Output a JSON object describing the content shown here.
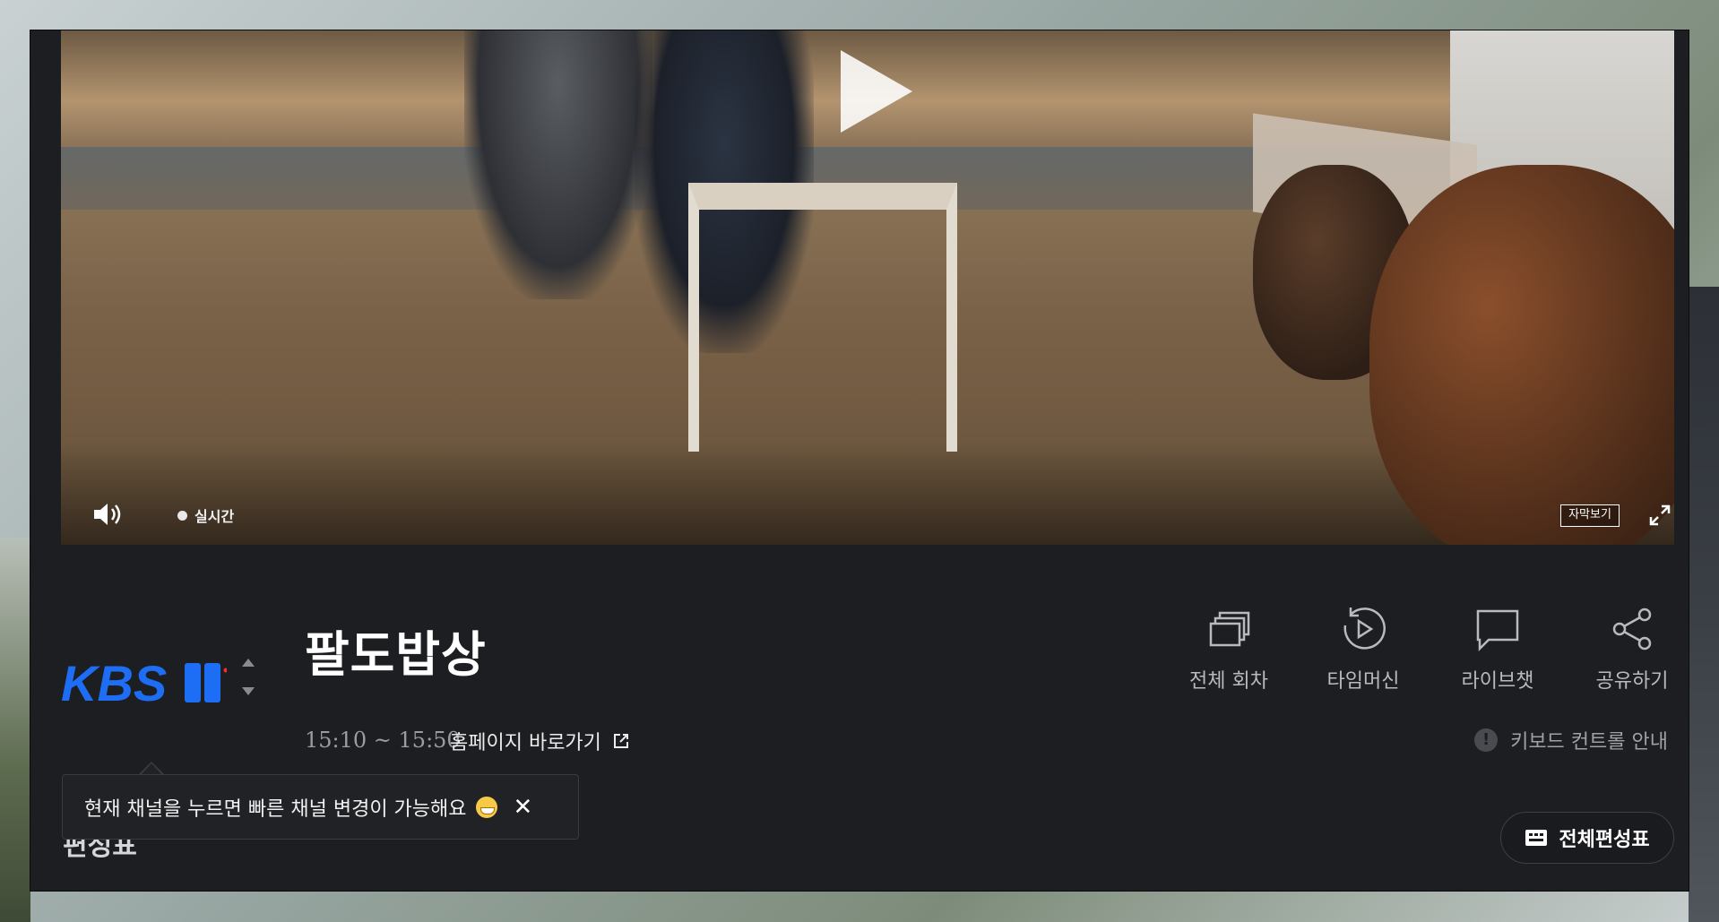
{
  "player": {
    "live_label": "실시간",
    "subtitle_label": "자막보기",
    "icons": [
      "play-icon",
      "volume-icon",
      "fullscreen-icon"
    ]
  },
  "program": {
    "channel_logo": "KBS 1",
    "title": "팔도밥상",
    "time": "15:10 ~ 15:50",
    "homepage_label": "홈페이지 바로가기"
  },
  "actions": [
    {
      "label": "전체 회차",
      "icon": "episodes-icon"
    },
    {
      "label": "타임머신",
      "icon": "timemachine-icon"
    },
    {
      "label": "라이브챗",
      "icon": "chat-icon"
    },
    {
      "label": "공유하기",
      "icon": "share-icon"
    }
  ],
  "keyboard_guide": "키보드 컨트롤 안내",
  "tooltip": {
    "text": "현재 채널을 누르면 빠른 채널 변경이 가능해요"
  },
  "schedule_section_label": "편성표",
  "full_schedule_button": "전체편성표",
  "colors": {
    "panel_bg": "#1d1e22",
    "brand_blue": "#1d6ef5",
    "live_dot": "#e8e8e8"
  }
}
